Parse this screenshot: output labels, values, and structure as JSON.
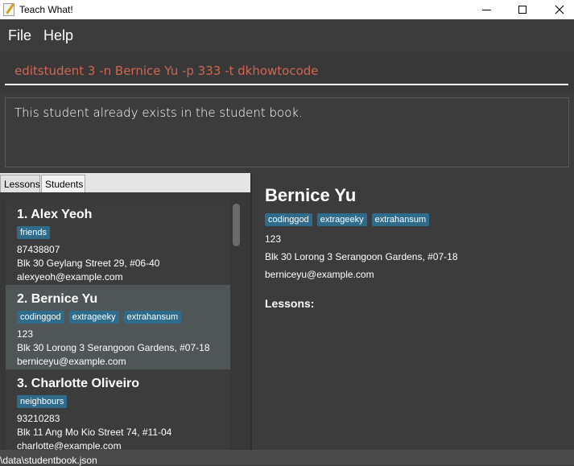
{
  "window": {
    "title": "Teach What!",
    "icon": "notepad-pencil-icon"
  },
  "menu": {
    "file": "File",
    "help": "Help"
  },
  "command": {
    "value": "editstudent 3 -n Bernice Yu -p 333 -t dkhowtocode",
    "text_color": "#d06651"
  },
  "result": {
    "message": "This student already exists in the student book."
  },
  "tabs": [
    {
      "label": "Lessons"
    },
    {
      "label": "Students"
    }
  ],
  "students": [
    {
      "title": "1.  Alex Yeoh",
      "tags": [
        "friends"
      ],
      "phone": "87438807",
      "address": "Blk 30 Geylang Street 29, #06-40",
      "email": "alexyeoh@example.com"
    },
    {
      "title": "2.  Bernice Yu",
      "tags": [
        "codinggod",
        "extrageeky",
        "extrahansum"
      ],
      "phone": "123",
      "address": "Blk 30 Lorong 3 Serangoon Gardens, #07-18",
      "email": "berniceyu@example.com"
    },
    {
      "title": "3.  Charlotte Oliveiro",
      "tags": [
        "neighbours"
      ],
      "phone": "93210283",
      "address": "Blk 11 Ang Mo Kio Street 74, #11-04",
      "email": "charlotte@example.com"
    }
  ],
  "detail": {
    "name": "Bernice Yu",
    "tags": [
      "codinggod",
      "extrageeky",
      "extrahansum"
    ],
    "phone": "123",
    "address": "Blk 30 Lorong 3 Serangoon Gardens, #07-18",
    "email": "berniceyu@example.com",
    "lessons_label": "Lessons:"
  },
  "status": {
    "path": "\\data\\studentbook.json"
  },
  "colors": {
    "tag_bg": "#2f6b8a",
    "selected_card": "#505558"
  }
}
